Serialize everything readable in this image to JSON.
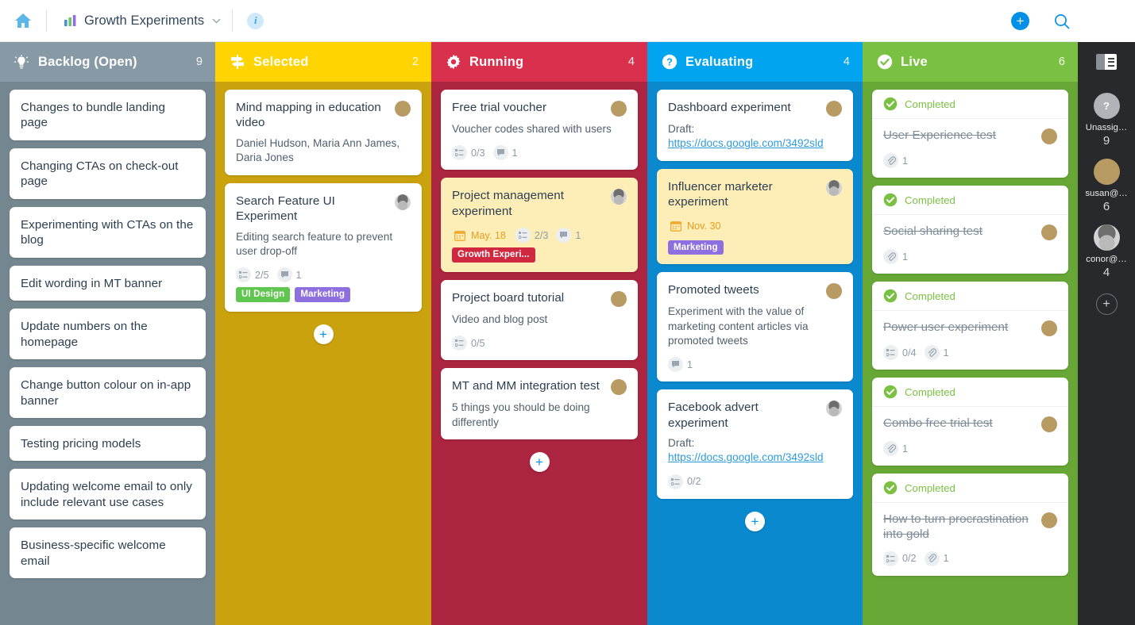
{
  "topbar": {
    "home_icon": "home-icon",
    "board_icon": "bar-chart-icon",
    "board_title": "Growth Experiments",
    "chevron": "⌄",
    "info_label": "i",
    "add_label": "+",
    "search_icon": "search-icon",
    "avatar_name": "user-avatar"
  },
  "columns": [
    {
      "id": "backlog",
      "icon": "lightbulb-icon",
      "title": "Backlog (Open)",
      "count": "9",
      "header_color": "#8899a6",
      "body_color": "#74868f",
      "cards": [
        {
          "title": "Changes to bundle landing page"
        },
        {
          "title": "Changing CTAs on check-out page"
        },
        {
          "title": "Experimenting with CTAs on the blog"
        },
        {
          "title": "Edit wording in MT banner"
        },
        {
          "title": "Update numbers on the homepage"
        },
        {
          "title": "Change button colour on in-app banner"
        },
        {
          "title": "Testing pricing models"
        },
        {
          "title": "Updating welcome email to only include relevant use cases"
        },
        {
          "title": "Business-specific welcome email"
        }
      ],
      "show_add": false
    },
    {
      "id": "selected",
      "icon": "signpost-icon",
      "title": "Selected",
      "count": "2",
      "header_color": "#ffd400",
      "body_color": "#c9a20d",
      "cards": [
        {
          "title": "Mind mapping in education video",
          "desc": "Daniel Hudson, Maria Ann James, Daria Jones",
          "avatar": "susan"
        },
        {
          "title": "Search Feature UI Experiment",
          "desc": "Editing search feature to prevent user drop-off",
          "avatar": "conor",
          "checklist": "2/5",
          "comments": "1",
          "tags": [
            {
              "label": "UI Design",
              "class": "tag-uidesign"
            },
            {
              "label": "Marketing",
              "class": "tag-marketing"
            }
          ]
        }
      ],
      "add_label": "+",
      "show_add": true
    },
    {
      "id": "running",
      "icon": "gear-icon",
      "title": "Running",
      "count": "4",
      "header_color": "#d8304d",
      "body_color": "#ab2440",
      "cards": [
        {
          "title": "Free trial voucher",
          "desc": "Voucher codes shared with users",
          "avatar": "susan",
          "checklist": "0/3",
          "comments": "1"
        },
        {
          "title": "Project management experiment",
          "cream": true,
          "avatar": "conor",
          "date": "May. 18",
          "checklist": "2/3",
          "comments": "1",
          "tags": [
            {
              "label": "Growth Experi...",
              "class": "tag-growth"
            }
          ]
        },
        {
          "title": "Project board tutorial",
          "desc": "Video and blog post",
          "avatar": "susan",
          "checklist": "0/5"
        },
        {
          "title": "MT and MM integration test",
          "desc": "5 things you should be doing differently",
          "avatar": "susan"
        }
      ],
      "add_label": "+",
      "show_add": true
    },
    {
      "id": "evaluating",
      "icon": "question-circle-icon",
      "title": "Evaluating",
      "count": "4",
      "header_color": "#00a4ef",
      "body_color": "#0a89cf",
      "cards": [
        {
          "title": "Dashboard experiment",
          "desc": "Draft:",
          "link": "https://docs.google.com/3492sld",
          "avatar": "susan"
        },
        {
          "title": "Influencer marketer experiment",
          "cream": true,
          "avatar": "conor",
          "date": "Nov. 30",
          "tags": [
            {
              "label": "Marketing",
              "class": "tag-marketing"
            }
          ]
        },
        {
          "title": "Promoted tweets",
          "desc": "Experiment with the value of marketing content articles via promoted tweets",
          "avatar": "susan",
          "comments": "1"
        },
        {
          "title": "Facebook advert experiment",
          "desc": "Draft:",
          "link": "https://docs.google.com/3492sld",
          "avatar": "conor",
          "checklist": "0/2"
        }
      ],
      "add_label": "+",
      "show_add": true
    },
    {
      "id": "live",
      "icon": "check-circle-icon",
      "title": "Live",
      "count": "6",
      "header_color": "#7ac143",
      "body_color": "#66a736",
      "cards": [
        {
          "completed_label": "Completed",
          "title": "User Experience test",
          "avatar": "susan",
          "attachments": "1"
        },
        {
          "completed_label": "Completed",
          "title": "Social sharing test",
          "avatar": "susan",
          "attachments": "1"
        },
        {
          "completed_label": "Completed",
          "title": "Power user experiment",
          "avatar": "susan",
          "checklist": "0/4",
          "attachments": "1"
        },
        {
          "completed_label": "Completed",
          "title": "Combo free trial test",
          "avatar": "susan",
          "attachments": "1"
        },
        {
          "completed_label": "Completed",
          "title": "How to turn procrastination into gold",
          "avatar": "susan",
          "checklist": "0/2",
          "attachments": "1"
        }
      ],
      "show_add": false
    }
  ],
  "rail": {
    "toggle_icon": "panel-toggle-icon",
    "users": [
      {
        "avatar": "unassigned",
        "initial": "?",
        "name": "Unassig…",
        "count": "9"
      },
      {
        "avatar": "susan",
        "name": "susan@…",
        "count": "6"
      },
      {
        "avatar": "conor",
        "name": "conor@…",
        "count": "4"
      }
    ],
    "add_label": "+"
  }
}
